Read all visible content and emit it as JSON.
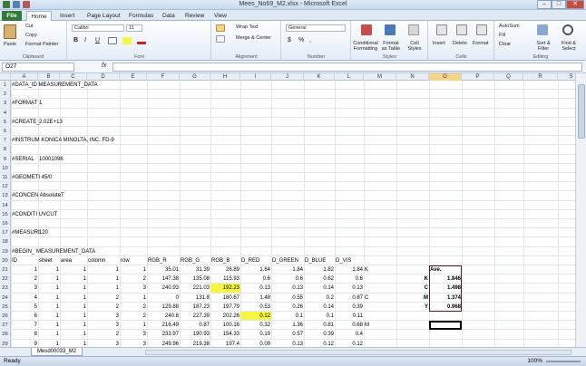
{
  "window": {
    "title": "Mees_No69_M2.xlsx - Microsoft Excel",
    "minimize": "–",
    "maximize": "□",
    "close": "✕"
  },
  "tabs": [
    "File",
    "Home",
    "Insert",
    "Page Layout",
    "Formulas",
    "Data",
    "Review",
    "View"
  ],
  "ribbon": {
    "clipboard": {
      "label": "Clipboard",
      "paste": "Paste",
      "cut": "Cut",
      "copy": "Copy",
      "format_painter": "Format Painter"
    },
    "font": {
      "label": "Font",
      "name": "Calibri",
      "size": "11",
      "bold": "B",
      "italic": "I",
      "underline": "U"
    },
    "alignment": {
      "label": "Alignment",
      "wrap": "Wrap Text",
      "merge": "Merge & Center"
    },
    "number": {
      "label": "Number",
      "format": "General",
      "currency": "$",
      "percent": "%",
      "comma": ","
    },
    "styles": {
      "label": "Styles",
      "conditional": "Conditional Formatting",
      "table": "Format as Table",
      "cell": "Cell Styles"
    },
    "cells": {
      "label": "Cells",
      "insert": "Insert",
      "delete": "Delete",
      "format": "Format"
    },
    "editing": {
      "label": "Editing",
      "autosum": "AutoSum",
      "fill": "Fill",
      "clear": "Clear",
      "sort": "Sort & Filter",
      "find": "Find & Select"
    }
  },
  "formula_bar": {
    "name_box": "O27",
    "fx": "fx",
    "value": ""
  },
  "columns": [
    "A",
    "B",
    "C",
    "D",
    "E",
    "F",
    "G",
    "H",
    "I",
    "J",
    "K",
    "L",
    "M",
    "N",
    "O",
    "P",
    "Q",
    "R",
    "S"
  ],
  "row_numbers": [
    "1",
    "2",
    "3",
    "4",
    "5",
    "6",
    "7",
    "8",
    "9",
    "10",
    "11",
    "12",
    "13",
    "14",
    "15",
    "16",
    "17",
    "18",
    "19",
    "20",
    "21",
    "22",
    "23",
    "24",
    "25",
    "26",
    "27",
    "28",
    "29"
  ],
  "cells": {
    "A1": "#DATA_ID MEASUREMENT_DATA",
    "A3": "#FORMAT",
    "B3": "1",
    "A5": "#CREATE_",
    "B5": "2.02E+13",
    "A7": "#INSTRUM KONICA MINOLTA, INC. FD-9",
    "A9": "#SERIAL",
    "B9": "10001096",
    "A11": "#GEOMETI 45/0",
    "A13": "#CONCEN Absolute",
    "C13": "T",
    "A15": "#CONDITI UVCUT",
    "A17": "#MEASURI",
    "B17": "120",
    "A19": "#BEGIN_ MEASUREMENT_DATA"
  },
  "table_header": [
    "ID",
    "sheet",
    "area",
    "colomn",
    "row",
    "RGB_R",
    "RGB_G",
    "RGB_B",
    "D_RED",
    "D_GREEN",
    "D_BLUE",
    "D_VIS"
  ],
  "table_rows": [
    [
      "1",
      "1",
      "1",
      "1",
      "1",
      "35.01",
      "31.39",
      "26.89",
      "1.84",
      "1.84",
      "1.82",
      "1.84",
      "K"
    ],
    [
      "2",
      "1",
      "1",
      "1",
      "2",
      "147.38",
      "135.08",
      "115.93",
      "0.6",
      "0.6",
      "0.62",
      "0.6",
      ""
    ],
    [
      "3",
      "1",
      "1",
      "1",
      "3",
      "240.93",
      "221.03",
      "192.23",
      "0.13",
      "0.13",
      "0.14",
      "0.13",
      ""
    ],
    [
      "4",
      "1",
      "1",
      "2",
      "1",
      "0",
      "131.8",
      "180.67",
      "1.48",
      "0.55",
      "0.2",
      "0.87",
      "C"
    ],
    [
      "5",
      "1",
      "1",
      "2",
      "2",
      "129.88",
      "187.23",
      "197.79",
      "0.53",
      "0.26",
      "0.14",
      "0.39",
      ""
    ],
    [
      "6",
      "1",
      "1",
      "3",
      "2",
      "240.8",
      "227.39",
      "202.26",
      "0.12",
      "0.1",
      "0.1",
      "0.11",
      ""
    ],
    [
      "7",
      "1",
      "1",
      "3",
      "1",
      "216.49",
      "0.87",
      "100.16",
      "0.32",
      "1.36",
      "0.81",
      "0.68",
      "M"
    ],
    [
      "8",
      "1",
      "1",
      "2",
      "3",
      "233.97",
      "190.93",
      "154.33",
      "0.19",
      "0.57",
      "0.39",
      "0.4",
      ""
    ],
    [
      "9",
      "1",
      "1",
      "3",
      "3",
      "249.96",
      "219.38",
      "197.4",
      "0.09",
      "0.13",
      "0.12",
      "0.12",
      ""
    ]
  ],
  "highlights": [
    [
      20,
      11
    ],
    [
      23,
      8
    ],
    [
      26,
      9
    ]
  ],
  "ave": {
    "title": "Ave.",
    "labels": [
      "K",
      "C",
      "M",
      "Y"
    ],
    "values": [
      "1.846",
      "1.498",
      "1.374",
      "0.968"
    ]
  },
  "sheet_tab": "Mesd00033_M2",
  "status": {
    "ready": "Ready",
    "zoom": "100%"
  },
  "colors": {
    "file_tab": "#2f7a3a",
    "highlight": "#f5f542",
    "selected_col": "#f5d58a"
  }
}
